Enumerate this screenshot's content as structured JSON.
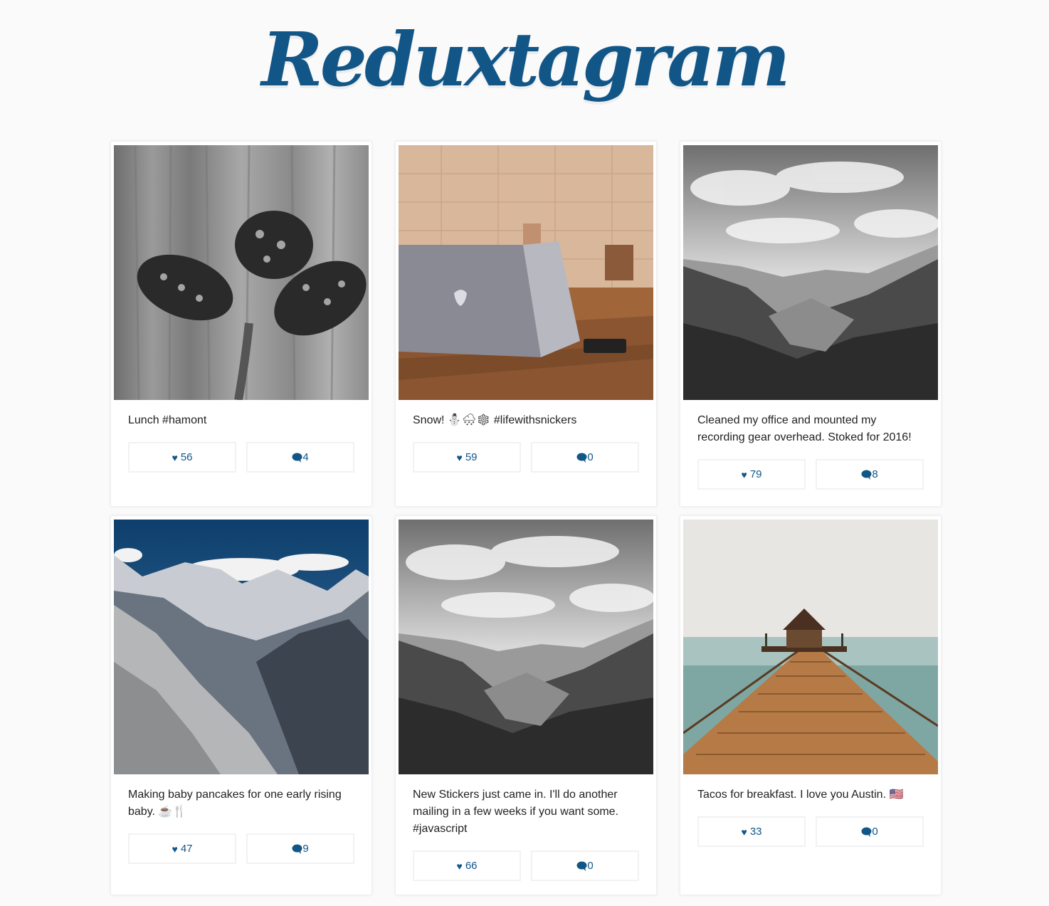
{
  "app": {
    "title": "Reduxtagram"
  },
  "posts": [
    {
      "caption": "Lunch #hamont",
      "likes": "56",
      "comments": "4",
      "photo": "pinecones-bw-icon"
    },
    {
      "caption": "Snow! ⛄🌨❄ #lifewithsnickers",
      "likes": "59",
      "comments": "0",
      "photo": "laptop-desk-icon"
    },
    {
      "caption": "Cleaned my office and mounted my recording gear overhead. Stoked for 2016!",
      "likes": "79",
      "comments": "8",
      "photo": "valley-bw-icon"
    },
    {
      "caption": "Making baby pancakes for one early rising baby. ☕🍴",
      "likes": "47",
      "comments": "9",
      "photo": "snowy-mountains-icon"
    },
    {
      "caption": "New Stickers just came in. I'll do another mailing in a few weeks if you want some. #javascript",
      "likes": "66",
      "comments": "0",
      "photo": "valley-bw-icon"
    },
    {
      "caption": "Tacos for breakfast. I love you Austin. 🇺🇸",
      "likes": "33",
      "comments": "0",
      "photo": "pier-sea-icon"
    }
  ],
  "colors": {
    "accent": "#125688",
    "background": "#fafafa"
  }
}
